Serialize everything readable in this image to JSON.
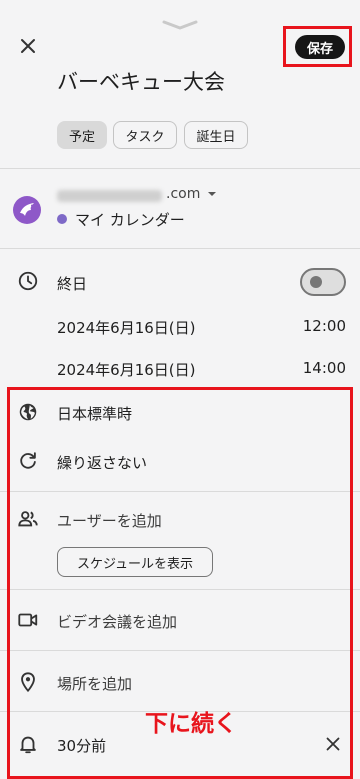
{
  "header": {
    "save_label": "保存"
  },
  "event": {
    "title": "バーベキュー大会"
  },
  "types": [
    {
      "label": "予定",
      "active": true
    },
    {
      "label": "タスク",
      "active": false
    },
    {
      "label": "誕生日",
      "active": false
    }
  ],
  "account": {
    "email_domain": ".com",
    "calendar_name": "マイ カレンダー",
    "calendar_color": "#7e69c7"
  },
  "allday": {
    "label": "終日",
    "enabled": false
  },
  "start": {
    "date": "2024年6月16日(日)",
    "time": "12:00"
  },
  "end": {
    "date": "2024年6月16日(日)",
    "time": "14:00"
  },
  "timezone": {
    "label": "日本標準時"
  },
  "repeat": {
    "label": "繰り返さない"
  },
  "guests": {
    "label": "ユーザーを追加",
    "schedule_button": "スケジュールを表示"
  },
  "video": {
    "label": "ビデオ会議を追加"
  },
  "location": {
    "label": "場所を追加"
  },
  "notification": {
    "label": "30分前"
  },
  "annotation": {
    "text": "下に続く",
    "color": "#e8141c"
  }
}
